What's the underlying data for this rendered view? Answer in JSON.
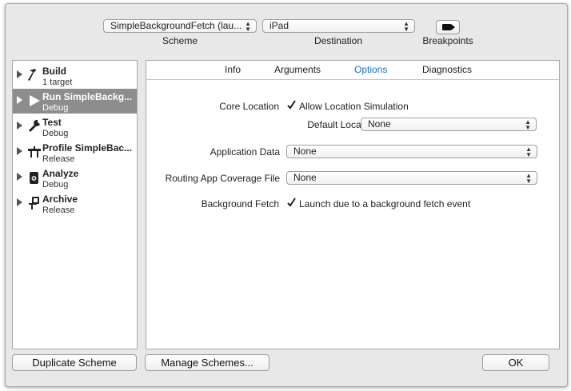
{
  "toolbar": {
    "scheme_value": "SimpleBackgroundFetch (lau...",
    "scheme_caption": "Scheme",
    "destination_value": "iPad",
    "destination_caption": "Destination",
    "breakpoints_caption": "Breakpoints",
    "breakpoints_icon": "breakpoint-icon"
  },
  "sidebar": {
    "actions": [
      {
        "title": "Build",
        "subtitle": "1 target",
        "icon": "hammer-icon",
        "selected": false
      },
      {
        "title": "Run SimpleBackg...",
        "subtitle": "Debug",
        "icon": "play-icon",
        "selected": true
      },
      {
        "title": "Test",
        "subtitle": "Debug",
        "icon": "wrench-icon",
        "selected": false
      },
      {
        "title": "Profile SimpleBac...",
        "subtitle": "Release",
        "icon": "instruments-icon",
        "selected": false
      },
      {
        "title": "Analyze",
        "subtitle": "Debug",
        "icon": "analyze-icon",
        "selected": false
      },
      {
        "title": "Archive",
        "subtitle": "Release",
        "icon": "archive-icon",
        "selected": false
      }
    ]
  },
  "tabs": [
    {
      "label": "Info",
      "active": false
    },
    {
      "label": "Arguments",
      "active": false
    },
    {
      "label": "Options",
      "active": true
    },
    {
      "label": "Diagnostics",
      "active": false
    }
  ],
  "options": {
    "core_location": {
      "label": "Core Location",
      "checkbox_label": "Allow Location Simulation",
      "checked": true,
      "default_location_label": "Default Location",
      "default_location_value": "None"
    },
    "application_data": {
      "label": "Application Data",
      "value": "None"
    },
    "routing_coverage": {
      "label": "Routing App Coverage File",
      "value": "None"
    },
    "background_fetch": {
      "label": "Background Fetch",
      "checkbox_label": "Launch due to a background fetch event",
      "checked": true
    }
  },
  "footer": {
    "duplicate_label": "Duplicate Scheme",
    "manage_label": "Manage Schemes...",
    "ok_label": "OK"
  },
  "colors": {
    "active_tab": "#1a6fd8",
    "selected_row": "#8d8d8d"
  }
}
